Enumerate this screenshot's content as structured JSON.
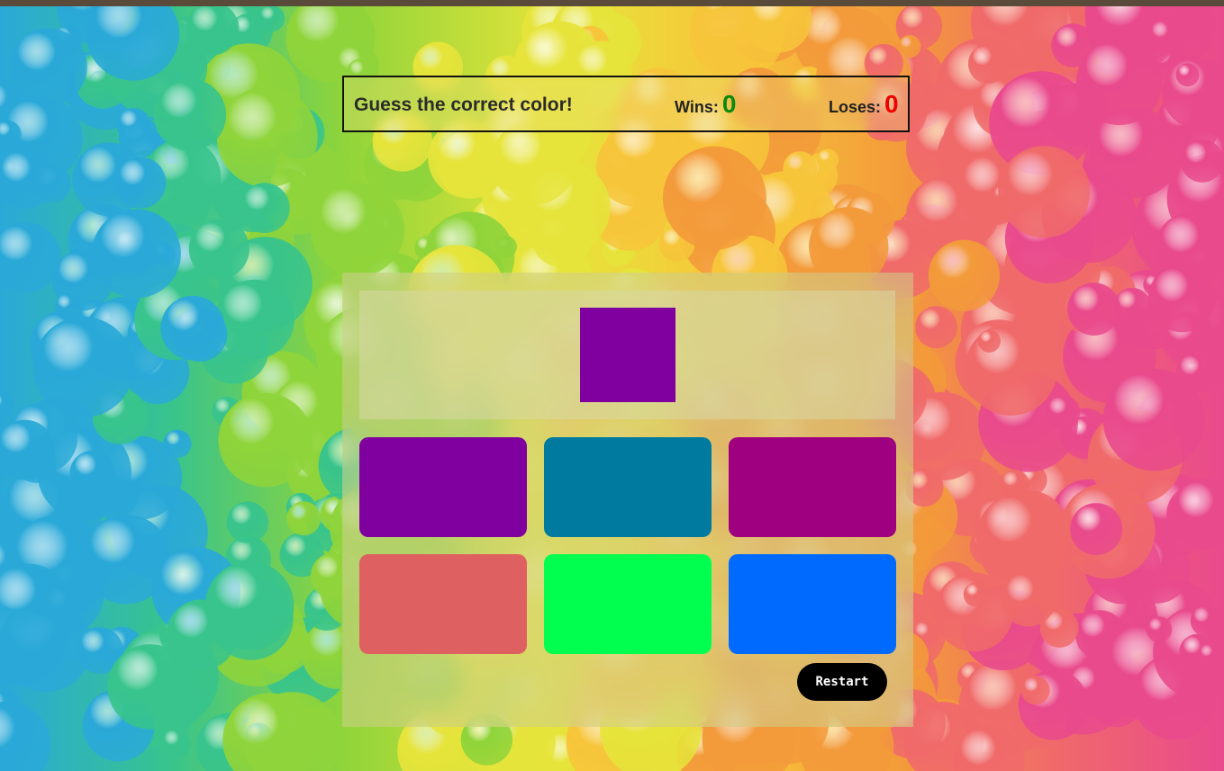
{
  "header": {
    "title": "Guess the correct color!",
    "wins_label": "Wins:",
    "wins_value": "0",
    "loses_label": "Loses:",
    "loses_value": "0"
  },
  "target": {
    "color": "#7f009f"
  },
  "options": [
    {
      "color": "#7f009f"
    },
    {
      "color": "#007b9f"
    },
    {
      "color": "#9f007f"
    },
    {
      "color": "#df6060"
    },
    {
      "color": "#00ff4f"
    },
    {
      "color": "#006aff"
    }
  ],
  "controls": {
    "restart_label": "Restart"
  },
  "background": {
    "colors": [
      "#2aa9d8",
      "#38c48c",
      "#8fd43a",
      "#e6e43a",
      "#f7c53a",
      "#f39a3a",
      "#f06a6a",
      "#e94a8c"
    ]
  }
}
